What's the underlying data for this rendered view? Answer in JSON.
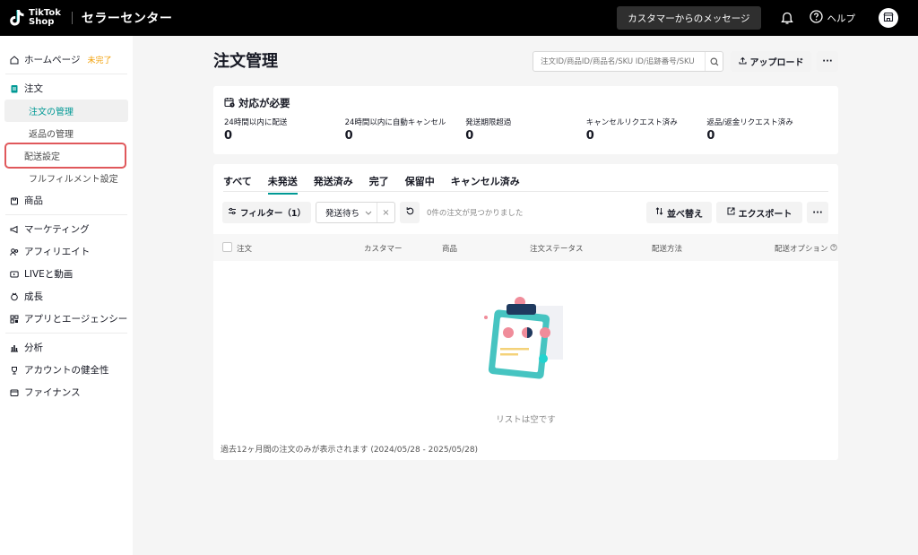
{
  "header": {
    "logo_line1": "TikTok",
    "logo_line2": "Shop",
    "app_title": "セラーセンター",
    "message_button": "カスタマーからのメッセージ",
    "help_label": "ヘルプ"
  },
  "sidebar": {
    "home": "ホームページ",
    "home_badge": "未完了",
    "orders": "注文",
    "orders_sub": [
      "注文の管理",
      "返品の管理",
      "配送設定",
      "フルフィルメント設定"
    ],
    "products": "商品",
    "marketing": "マーケティング",
    "affiliate": "アフィリエイト",
    "live": "LIVEと動画",
    "growth": "成長",
    "apps": "アプリとエージェンシー",
    "analytics": "分析",
    "account_health": "アカウントの健全性",
    "finance": "ファイナンス"
  },
  "main": {
    "title": "注文管理",
    "search_placeholder": "注文ID/商品ID/商品名/SKU ID/追跡番号/SKU",
    "upload_button": "アップロード",
    "more_glyph": "···",
    "attention": {
      "title": "対応が必要",
      "metrics": [
        {
          "label": "24時間以内に配送",
          "value": "0"
        },
        {
          "label": "24時間以内に自動キャンセル",
          "value": "0"
        },
        {
          "label": "発送期限超過",
          "value": "0"
        },
        {
          "label": "キャンセルリクエスト済み",
          "value": "0"
        },
        {
          "label": "返品/返金リクエスト済み",
          "value": "0"
        }
      ]
    },
    "tabs": [
      "すべて",
      "未発送",
      "発送済み",
      "完了",
      "保留中",
      "キャンセル済み"
    ],
    "active_tab": "未発送",
    "filter_button": "フィルター（1）",
    "status_filter": "発送待ち",
    "clear_glyph": "×",
    "found_text": "0件の注文が見つかりました",
    "sort_button": "並べ替え",
    "export_button": "エクスポート",
    "columns": [
      "注文",
      "カスタマー",
      "商品",
      "注文ステータス",
      "配送方法",
      "配送オプション"
    ],
    "empty_text": "リストは空です",
    "footnote": "過去12ヶ月間の注文のみが表示されます (2024/05/28 - 2025/05/28)"
  },
  "colors": {
    "accent": "#009995",
    "highlight_border": "#e0585b",
    "pending_badge": "#f2a008"
  }
}
